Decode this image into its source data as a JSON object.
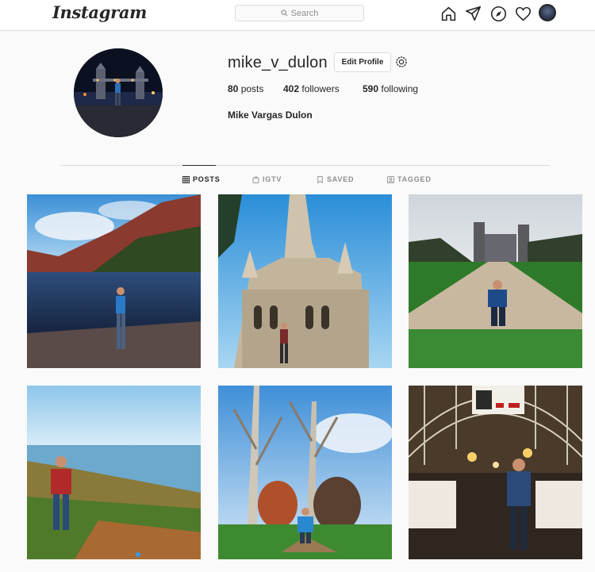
{
  "header": {
    "logo_text": "Instagram",
    "search_placeholder": "Search",
    "icons": [
      "home-icon",
      "direct-message-icon",
      "explore-icon",
      "activity-heart-icon",
      "profile-avatar"
    ]
  },
  "profile": {
    "username": "mike_v_dulon",
    "edit_profile_label": "Edit Profile",
    "posts_count": "80",
    "posts_label": "posts",
    "followers_count": "402",
    "followers_label": "followers",
    "following_count": "590",
    "following_label": "following",
    "full_name": "Mike Vargas Dulon"
  },
  "tabs": [
    {
      "label": "POSTS",
      "icon": "grid-icon",
      "active": true
    },
    {
      "label": "IGTV",
      "icon": "igtv-icon",
      "active": false
    },
    {
      "label": "SAVED",
      "icon": "bookmark-icon",
      "active": false
    },
    {
      "label": "TAGGED",
      "icon": "tag-icon",
      "active": false
    }
  ],
  "posts": [
    {
      "scene": "lake-mountains"
    },
    {
      "scene": "cathedral"
    },
    {
      "scene": "castle-path"
    },
    {
      "scene": "sea-cliff"
    },
    {
      "scene": "bare-trees"
    },
    {
      "scene": "glass-arcade"
    }
  ],
  "colors": {
    "background": "#fafafa",
    "text": "#262626",
    "secondary_text": "#8e8e8e",
    "border": "#dbdbdb"
  }
}
